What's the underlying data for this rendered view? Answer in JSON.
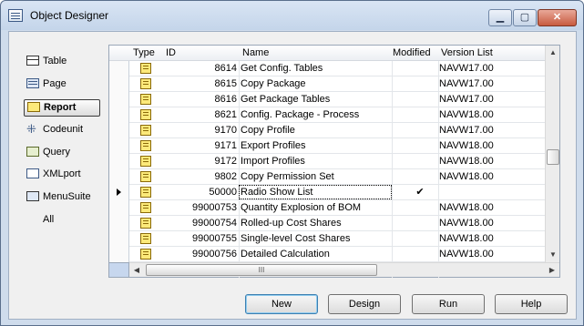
{
  "window": {
    "title": "Object Designer"
  },
  "title_buttons": {
    "minimize": "▁",
    "maximize": "▢",
    "close": "✕"
  },
  "nav": {
    "items": [
      {
        "label": "Table",
        "icon": "table-icon"
      },
      {
        "label": "Page",
        "icon": "page-icon"
      },
      {
        "label": "Report",
        "icon": "report-icon",
        "active": true
      },
      {
        "label": "Codeunit",
        "icon": "codeunit-icon"
      },
      {
        "label": "Query",
        "icon": "query-icon"
      },
      {
        "label": "XMLport",
        "icon": "xmlport-icon"
      },
      {
        "label": "MenuSuite",
        "icon": "menusuite-icon"
      },
      {
        "label": "All",
        "icon": ""
      }
    ]
  },
  "grid": {
    "columns": [
      "Type",
      "ID",
      "Name",
      "Modified",
      "Version List"
    ],
    "rows": [
      {
        "id": "8614",
        "name": "Get Config. Tables",
        "modified": "",
        "version": "NAVW17.00"
      },
      {
        "id": "8615",
        "name": "Copy Package",
        "modified": "",
        "version": "NAVW17.00"
      },
      {
        "id": "8616",
        "name": "Get Package Tables",
        "modified": "",
        "version": "NAVW17.00"
      },
      {
        "id": "8621",
        "name": "Config. Package - Process",
        "modified": "",
        "version": "NAVW18.00"
      },
      {
        "id": "9170",
        "name": "Copy Profile",
        "modified": "",
        "version": "NAVW17.00"
      },
      {
        "id": "9171",
        "name": "Export Profiles",
        "modified": "",
        "version": "NAVW18.00"
      },
      {
        "id": "9172",
        "name": "Import Profiles",
        "modified": "",
        "version": "NAVW18.00"
      },
      {
        "id": "9802",
        "name": "Copy Permission Set",
        "modified": "",
        "version": "NAVW18.00"
      },
      {
        "id": "50000",
        "name": "Radio Show List",
        "modified": "✔",
        "version": "",
        "current": true
      },
      {
        "id": "99000753",
        "name": "Quantity Explosion of BOM",
        "modified": "",
        "version": "NAVW18.00"
      },
      {
        "id": "99000754",
        "name": "Rolled-up Cost Shares",
        "modified": "",
        "version": "NAVW18.00"
      },
      {
        "id": "99000755",
        "name": "Single-level Cost Shares",
        "modified": "",
        "version": "NAVW18.00"
      },
      {
        "id": "99000756",
        "name": "Detailed Calculation",
        "modified": "",
        "version": "NAVW18.00"
      }
    ],
    "hscroll_grip": "III"
  },
  "buttons": {
    "new": "New",
    "design": "Design",
    "run": "Run",
    "help": "Help"
  }
}
